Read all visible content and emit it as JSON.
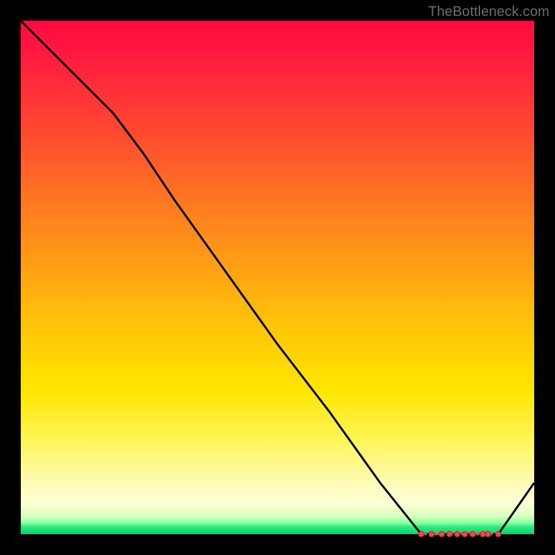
{
  "watermark": "TheBottleneck.com",
  "colors": {
    "line": "#000000",
    "marker_fill": "#e94b4b",
    "marker_stroke": "#b02020",
    "gradient_top": "#ff0a40",
    "gradient_bottom": "#00d86a"
  },
  "chart_data": {
    "type": "line",
    "title": "",
    "xlabel": "",
    "ylabel": "",
    "xlim": [
      0,
      100
    ],
    "ylim": [
      0,
      100
    ],
    "grid": false,
    "x": [
      0,
      3,
      10,
      18,
      24,
      30,
      40,
      50,
      60,
      70,
      78,
      81,
      83,
      85,
      87,
      89,
      91,
      93,
      100
    ],
    "y": [
      100,
      97,
      90,
      82,
      74,
      65,
      51,
      37,
      24,
      10,
      0,
      0,
      0,
      0,
      0,
      0,
      0,
      0,
      10
    ],
    "markers_x": [
      78,
      80,
      82,
      83.5,
      85,
      86.5,
      88,
      90,
      91,
      93
    ],
    "markers_y": [
      0,
      0,
      0,
      0,
      0,
      0,
      0,
      0,
      0,
      0
    ],
    "annotations": []
  }
}
